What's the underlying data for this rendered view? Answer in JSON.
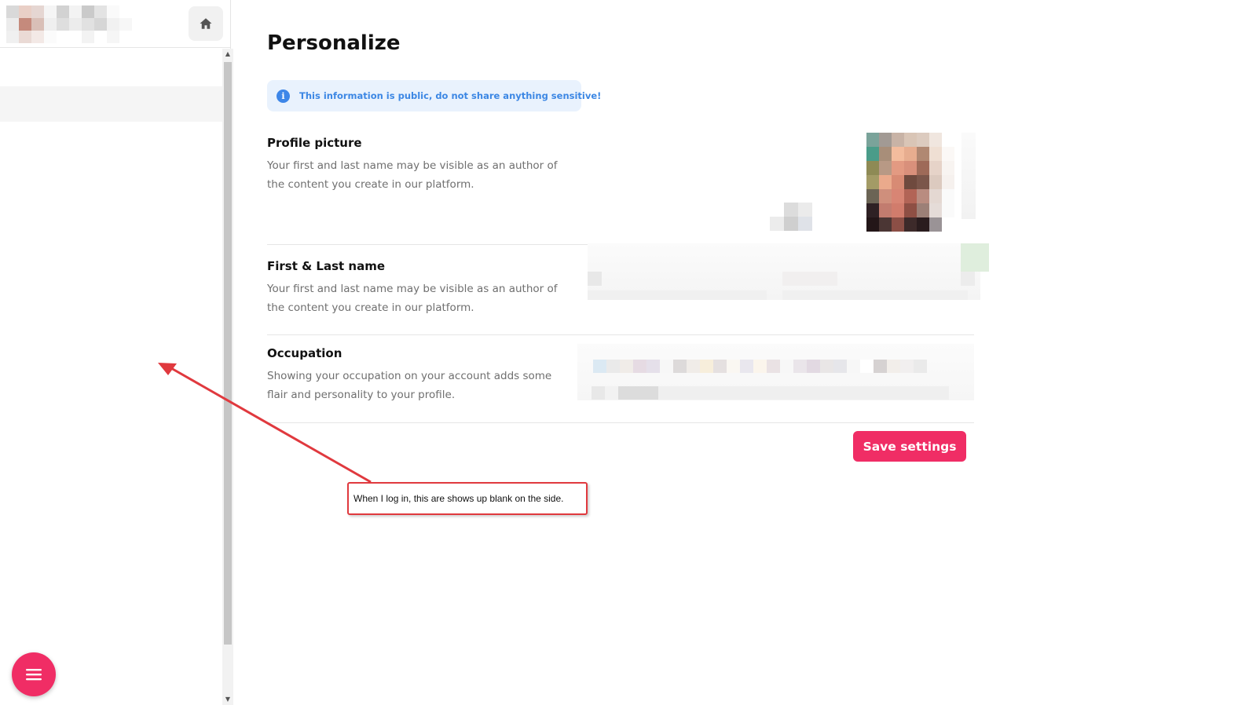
{
  "sidebar": {
    "home_icon": "home-icon",
    "menu_icon": "menu-icon"
  },
  "main": {
    "title": "Personalize",
    "notice": {
      "icon": "info-icon",
      "text": "This information is public, do not share anything sensitive!"
    },
    "sections": [
      {
        "title": "Profile picture",
        "description": "Your first and last name may be visible as an author of the content you create in our platform."
      },
      {
        "title": "First & Last name",
        "description": "Your first and last name may be visible as an author of the content you create in our platform."
      },
      {
        "title": "Occupation",
        "description": "Showing your occupation on your account adds some flair and personality to your profile."
      }
    ],
    "save_label": "Save settings"
  },
  "annotation": {
    "text": "When I log in, this are shows up blank on the side."
  },
  "colors": {
    "accent": "#f02d65",
    "notice_bg": "#e9f2fd",
    "notice_text": "#3c87e4",
    "annotation_red": "#e0393e"
  }
}
